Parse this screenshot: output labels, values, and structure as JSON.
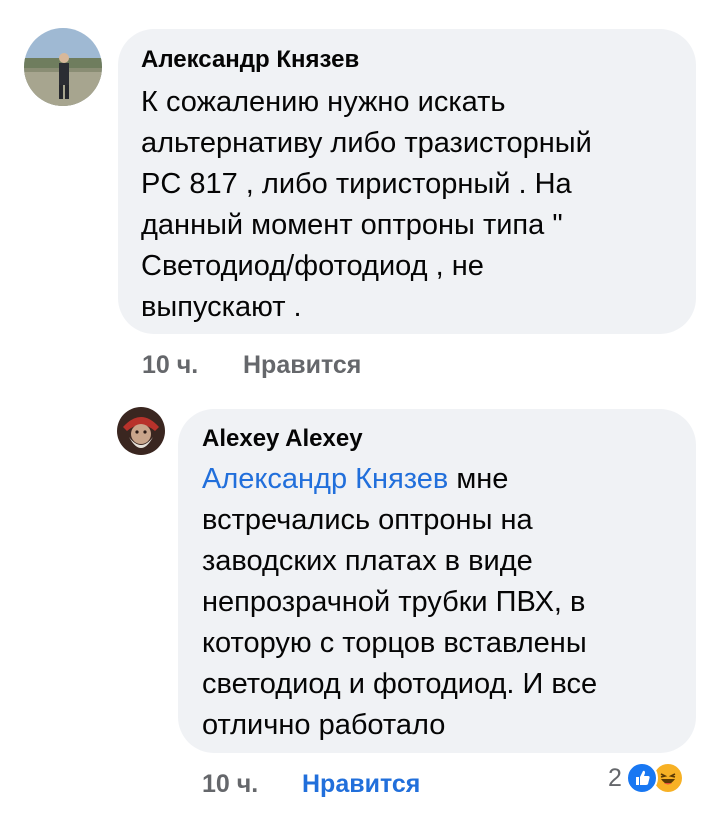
{
  "comments": [
    {
      "author": "Александр Князев",
      "body_lines": [
        "К сожалению нужно искать",
        "альтернативу либо тразисторный",
        "PC 817 , либо тиристорный . На",
        "данный момент оптроны типа \"",
        "Светодиод/фотодиод , не",
        "выпускают ."
      ],
      "time": "10 ч.",
      "like_label": "Нравится"
    }
  ],
  "reply": {
    "author": "Alexey Alexey",
    "mention": "Александр Князев",
    "first_line_rest": " мне",
    "body_lines": [
      "встречались оптроны на",
      "заводских платах в виде",
      "непрозрачной трубки ПВХ, в",
      "которую с торцов вставлены",
      "светодиод и фотодиод. И все",
      "отлично работало"
    ],
    "time": "10 ч.",
    "like_label": "Нравится",
    "reaction_count": "2",
    "reaction_icons": [
      "like-icon",
      "haha-icon"
    ]
  },
  "colors": {
    "bubble": "#f0f2f5",
    "mention": "#216fdb",
    "meta": "#65676b",
    "like_active": "#216fdb"
  }
}
